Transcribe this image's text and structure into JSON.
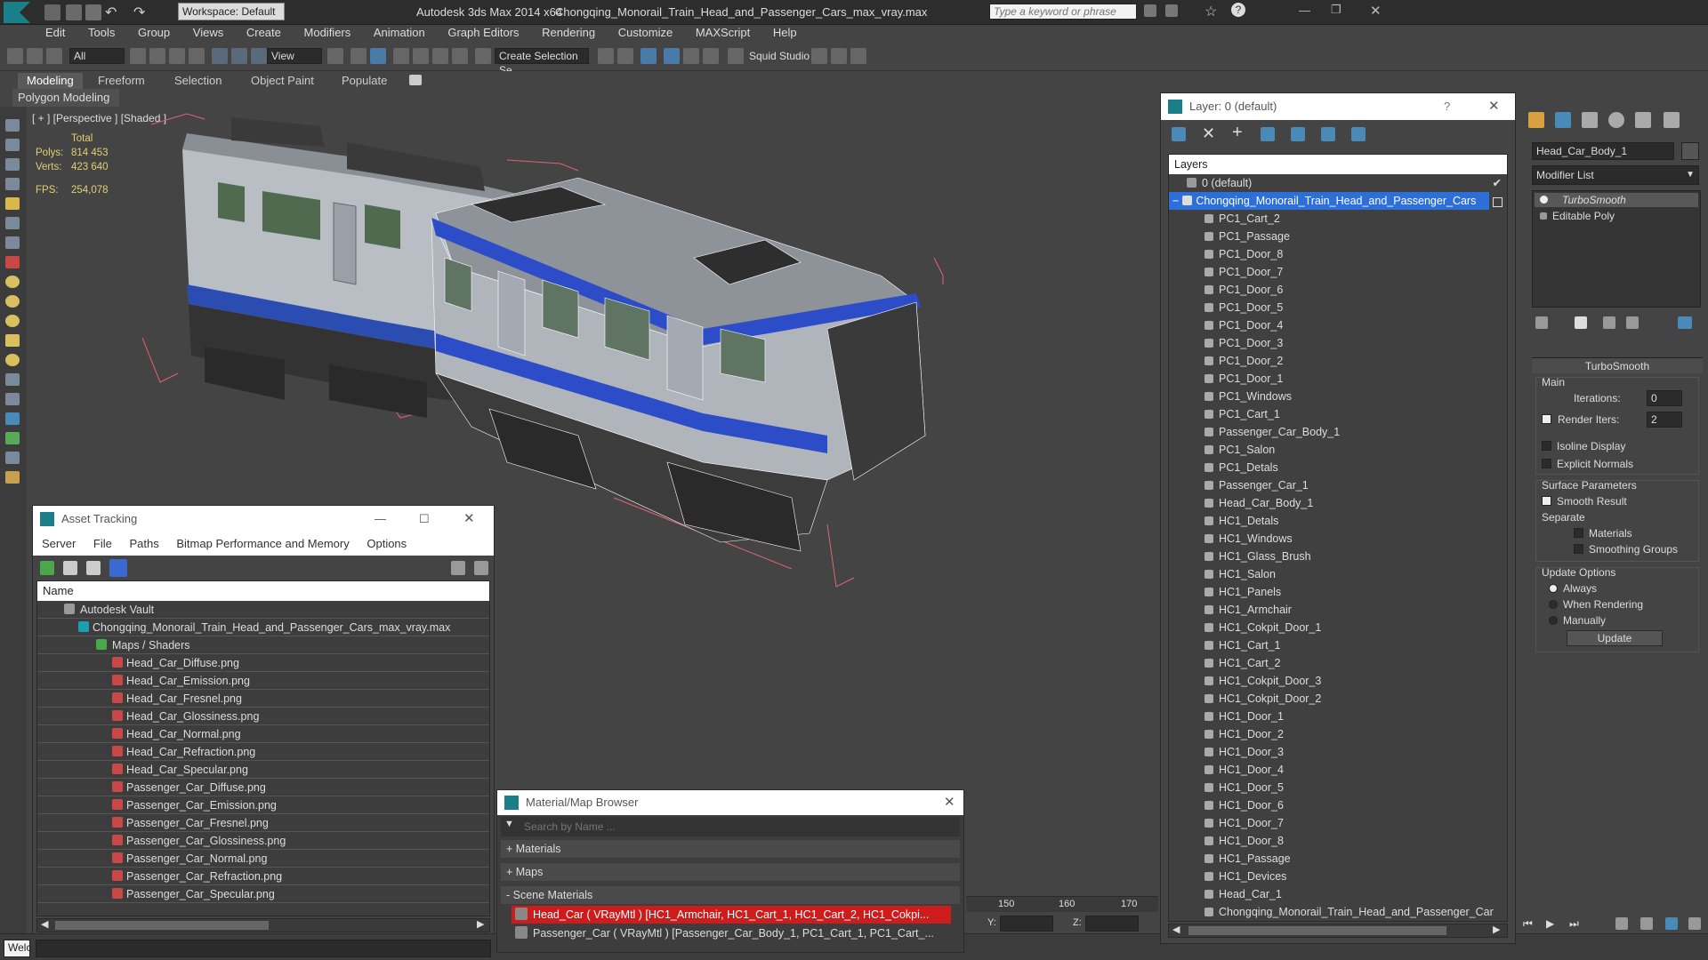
{
  "title": {
    "workspace": "Workspace: Default",
    "app": "Autodesk 3ds Max  2014 x64",
    "file": "Chongqing_Monorail_Train_Head_and_Passenger_Cars_max_vray.max",
    "search_placeholder": "Type a keyword or phrase"
  },
  "menu": [
    "Edit",
    "Tools",
    "Group",
    "Views",
    "Create",
    "Modifiers",
    "Animation",
    "Graph Editors",
    "Rendering",
    "Customize",
    "MAXScript",
    "Help"
  ],
  "toolbar": {
    "filter": "All",
    "view": "View",
    "selection_set": "Create Selection Se",
    "squid": "Squid Studio v"
  },
  "ribbon": {
    "tabs": [
      "Modeling",
      "Freeform",
      "Selection",
      "Object Paint",
      "Populate"
    ],
    "sub": "Polygon Modeling"
  },
  "viewport": {
    "label": "[ + ] [Perspective ] [Shaded ]",
    "stats_total": "Total",
    "polys_label": "Polys:",
    "polys": "814 453",
    "verts_label": "Verts:",
    "verts": "423 640",
    "fps_label": "FPS:",
    "fps": "254,078"
  },
  "asset_tracking": {
    "title": "Asset Tracking",
    "menu": [
      "Server",
      "File",
      "Paths",
      "Bitmap Performance and Memory",
      "Options"
    ],
    "column": "Name",
    "vault": "Autodesk Vault",
    "file": "Chongqing_Monorail_Train_Head_and_Passenger_Cars_max_vray.max",
    "maps_folder": "Maps / Shaders",
    "maps": [
      "Head_Car_Diffuse.png",
      "Head_Car_Emission.png",
      "Head_Car_Fresnel.png",
      "Head_Car_Glossiness.png",
      "Head_Car_Normal.png",
      "Head_Car_Refraction.png",
      "Head_Car_Specular.png",
      "Passenger_Car_Diffuse.png",
      "Passenger_Car_Emission.png",
      "Passenger_Car_Fresnel.png",
      "Passenger_Car_Glossiness.png",
      "Passenger_Car_Normal.png",
      "Passenger_Car_Refraction.png",
      "Passenger_Car_Specular.png"
    ]
  },
  "material_browser": {
    "title": "Material/Map Browser",
    "search": "Search by Name ...",
    "sections": [
      "+ Materials",
      "+ Maps",
      "- Scene Materials"
    ],
    "items": [
      "Head_Car  ( VRayMtl )  [HC1_Armchair, HC1_Cart_1, HC1_Cart_2, HC1_Cokpi...",
      "Passenger_Car  ( VRayMtl )  [Passenger_Car_Body_1, PC1_Cart_1, PC1_Cart_..."
    ]
  },
  "timeline": {
    "ticks": [
      "150",
      "160",
      "170"
    ],
    "y_label": "Y:",
    "z_label": "Z:"
  },
  "layers": {
    "title": "Layer: 0 (default)",
    "help": "?",
    "header": "Layers",
    "default": "0 (default)",
    "selected": "Chongqing_Monorail_Train_Head_and_Passenger_Cars",
    "children": [
      "PC1_Cart_2",
      "PC1_Passage",
      "PC1_Door_8",
      "PC1_Door_7",
      "PC1_Door_6",
      "PC1_Door_5",
      "PC1_Door_4",
      "PC1_Door_3",
      "PC1_Door_2",
      "PC1_Door_1",
      "PC1_Windows",
      "PC1_Cart_1",
      "Passenger_Car_Body_1",
      "PC1_Salon",
      "PC1_Detals",
      "Passenger_Car_1",
      "Head_Car_Body_1",
      "HC1_Detals",
      "HC1_Windows",
      "HC1_Glass_Brush",
      "HC1_Salon",
      "HC1_Panels",
      "HC1_Armchair",
      "HC1_Cokpit_Door_1",
      "HC1_Cart_1",
      "HC1_Cart_2",
      "HC1_Cokpit_Door_3",
      "HC1_Cokpit_Door_2",
      "HC1_Door_1",
      "HC1_Door_2",
      "HC1_Door_3",
      "HC1_Door_4",
      "HC1_Door_5",
      "HC1_Door_6",
      "HC1_Door_7",
      "HC1_Door_8",
      "HC1_Passage",
      "HC1_Devices",
      "Head_Car_1",
      "Chongqing_Monorail_Train_Head_and_Passenger_Car"
    ]
  },
  "command_panel": {
    "object_name": "Head_Car_Body_1",
    "modifier_list": "Modifier List",
    "stack": [
      "TurboSmooth",
      "Editable Poly"
    ],
    "rollout": "TurboSmooth",
    "main": "Main",
    "iterations_label": "Iterations:",
    "iterations": "0",
    "render_iters_label": "Render Iters:",
    "render_iters": "2",
    "isoline": "Isoline Display",
    "explicit": "Explicit Normals",
    "surface": "Surface Parameters",
    "smooth_result": "Smooth Result",
    "separate": "Separate",
    "materials": "Materials",
    "smoothing_groups": "Smoothing Groups",
    "update_options": "Update Options",
    "always": "Always",
    "when_rendering": "When Rendering",
    "manually": "Manually",
    "update": "Update"
  },
  "status": {
    "welcome": "Welc"
  }
}
